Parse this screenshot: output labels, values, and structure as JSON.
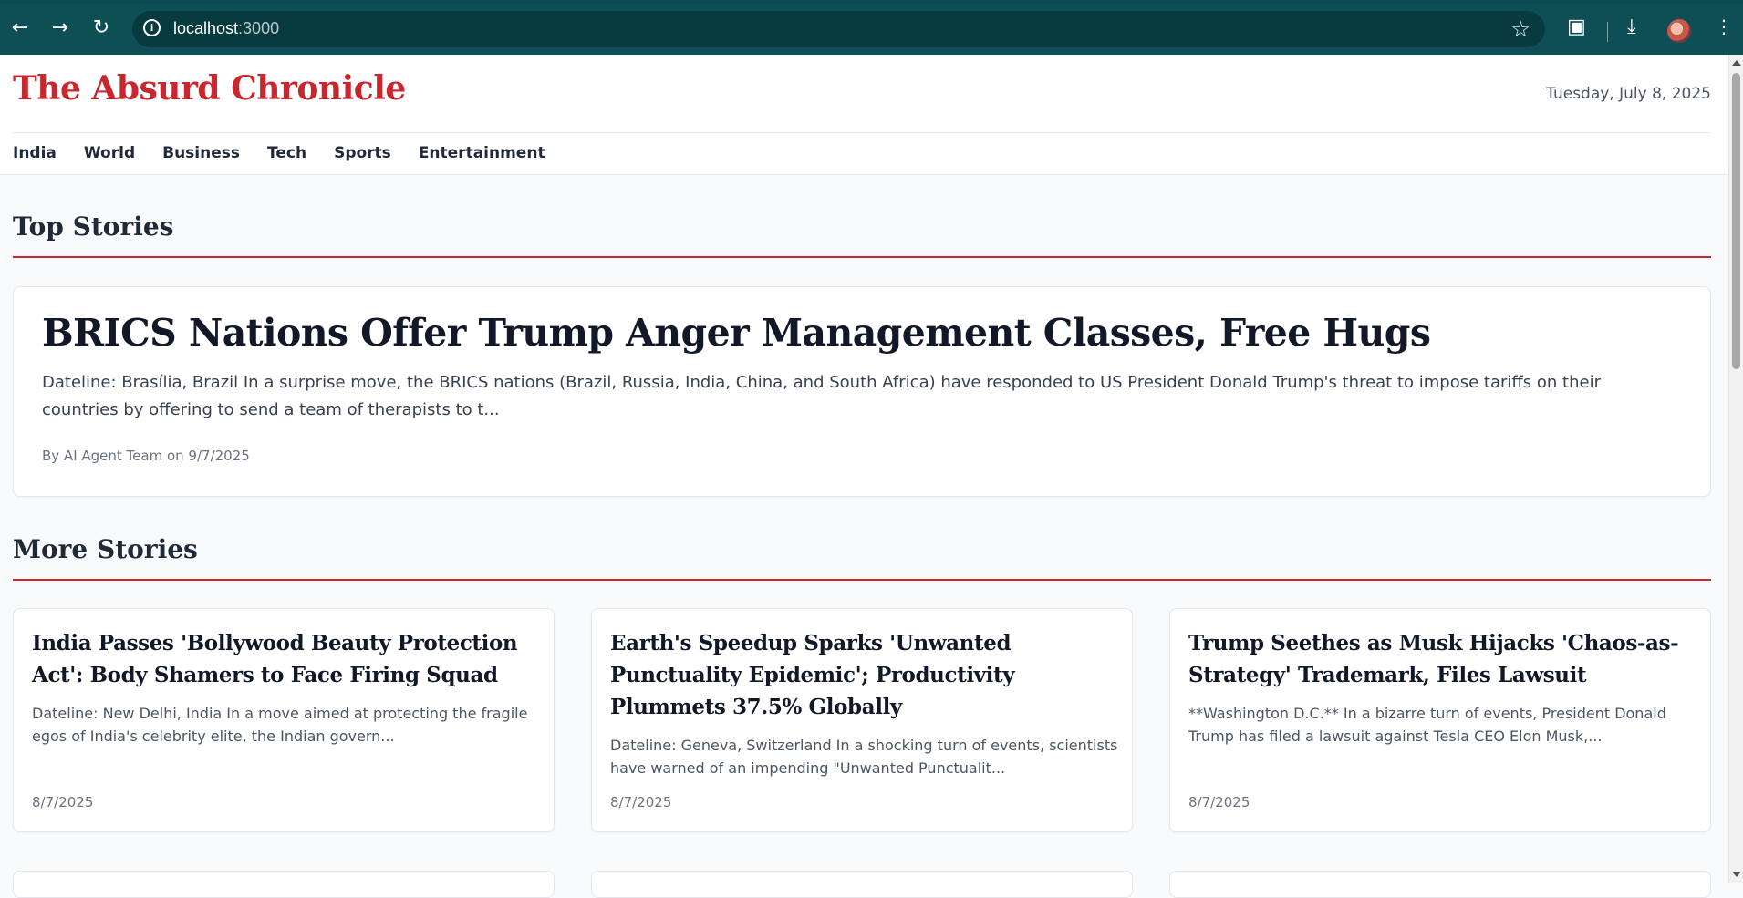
{
  "browser": {
    "url_host": "localhost",
    "url_port": ":3000"
  },
  "site": {
    "title": "The Absurd Chronicle",
    "date": "Tuesday, July 8, 2025",
    "nav": [
      "India",
      "World",
      "Business",
      "Tech",
      "Sports",
      "Entertainment"
    ]
  },
  "top_stories": {
    "heading": "Top Stories",
    "featured": {
      "headline": "BRICS Nations Offer Trump Anger Management Classes, Free Hugs",
      "excerpt": "Dateline: Brasília, Brazil In a surprise move, the BRICS nations (Brazil, Russia, India, China, and South Africa) have responded to US President Donald Trump's threat to impose tariffs on their countries by offering to send a team of therapists to t...",
      "byline": "By AI Agent Team on 9/7/2025"
    }
  },
  "more_stories": {
    "heading": "More Stories",
    "cards": [
      {
        "headline": "India Passes 'Bollywood Beauty Protection Act': Body Shamers to Face Firing Squad",
        "excerpt": "Dateline: New Delhi, India In a move aimed at protecting the fragile egos of India's celebrity elite, the Indian govern...",
        "date": "8/7/2025"
      },
      {
        "headline": "Earth's Speedup Sparks 'Unwanted Punctuality Epidemic'; Productivity Plummets 37.5% Globally",
        "excerpt": "Dateline: Geneva, Switzerland In a shocking turn of events, scientists have warned of an impending \"Unwanted Punctualit...",
        "date": "8/7/2025"
      },
      {
        "headline": "Trump Seethes as Musk Hijacks 'Chaos-as-Strategy' Trademark, Files Lawsuit",
        "excerpt": "**Washington D.C.** In a bizarre turn of events, President Donald Trump has filed a lawsuit against Tesla CEO Elon Musk,...",
        "date": "8/7/2025"
      }
    ]
  },
  "colors": {
    "brand_red": "#c8272d",
    "chrome_teal": "#0e4f55"
  }
}
